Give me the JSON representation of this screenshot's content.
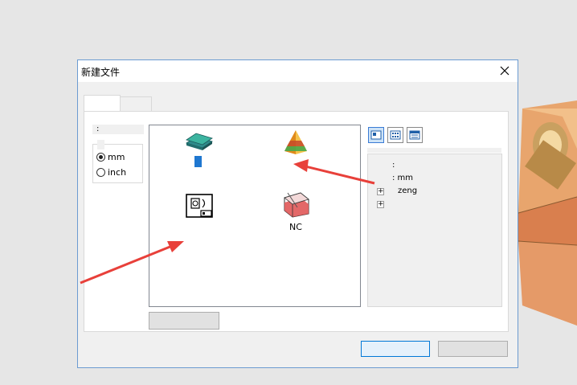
{
  "dialog": {
    "title": "新建文件",
    "close_icon": "close-icon"
  },
  "tabs": [
    "",
    ""
  ],
  "units": {
    "label": ":",
    "options": [
      {
        "label": "mm",
        "selected": true
      },
      {
        "label": "inch",
        "selected": false
      }
    ]
  },
  "templates": [
    {
      "icon": "stacked-layers-icon",
      "label": ""
    },
    {
      "icon": "pyramid-icon",
      "label": ""
    },
    {
      "icon": "drawing-sheet-icon",
      "label": ""
    },
    {
      "icon": "nc-machining-icon",
      "label": "NC"
    }
  ],
  "view_buttons": [
    "large-icons-view-icon",
    "list-view-icon",
    "details-view-icon"
  ],
  "info": {
    "line1": ":",
    "line2": ": mm",
    "line3": "zeng"
  },
  "colors": {
    "accent": "#0078d7",
    "arrow": "#e8403a",
    "part": "#e0925a"
  }
}
